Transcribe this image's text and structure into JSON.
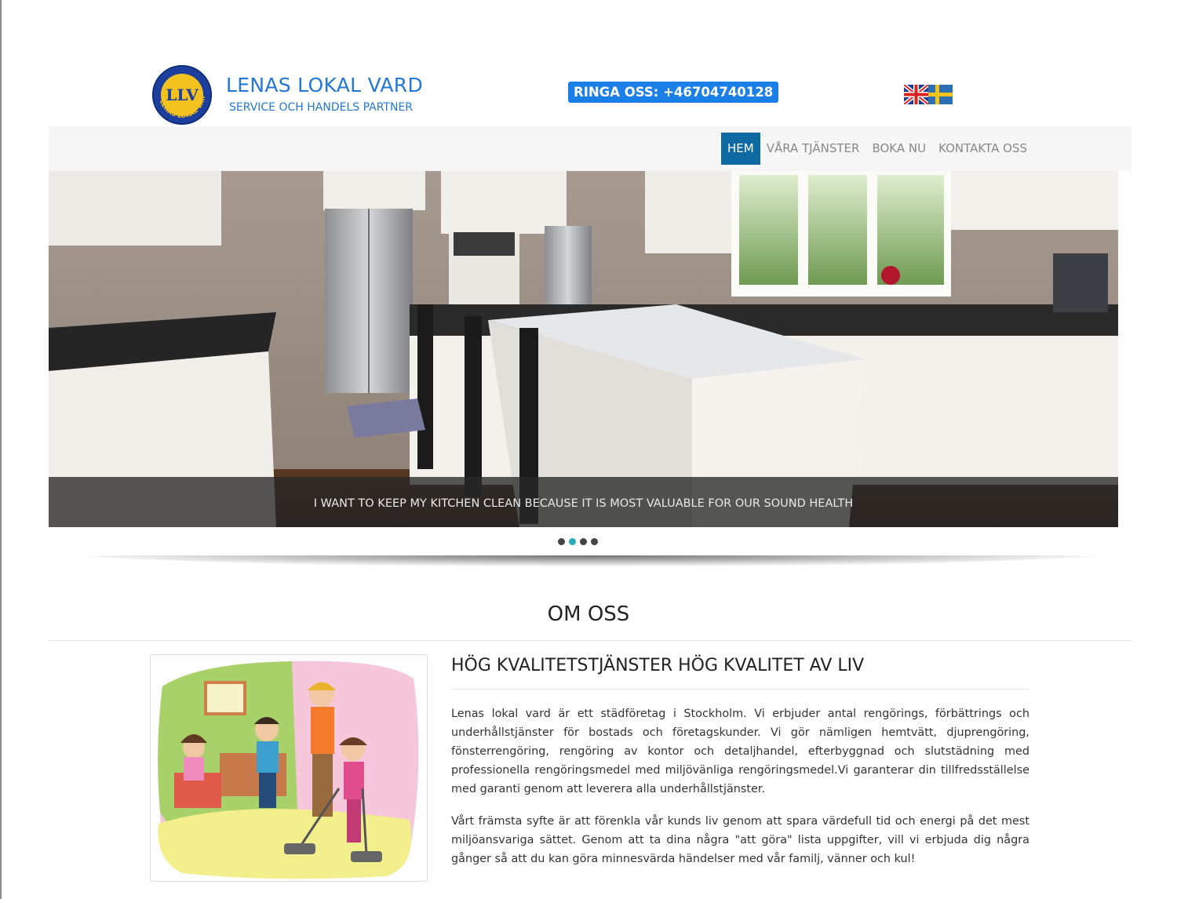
{
  "brand": {
    "title": "LENAS LOKAL VARD",
    "subtitle": "SERVICE OCH HANDELS PARTNER",
    "logo_text": "LENAS LOKAL VARD",
    "logo_initials": "LLV"
  },
  "header": {
    "call_label": "RINGA OSS: +46704740128"
  },
  "languages": [
    {
      "name": "english-flag-icon"
    },
    {
      "name": "swedish-flag-icon"
    }
  ],
  "nav": {
    "items": [
      {
        "label": "HEM",
        "active": true
      },
      {
        "label": "VÅRA TJÄNSTER",
        "active": false
      },
      {
        "label": "BOKA NU",
        "active": false
      },
      {
        "label": "KONTAKTA OSS",
        "active": false
      }
    ]
  },
  "carousel": {
    "caption": "I WANT TO KEEP MY KITCHEN CLEAN BECAUSE IT IS MOST VALUABLE FOR OUR SOUND HEALTH",
    "slide_count": 4,
    "active_index": 1
  },
  "about": {
    "title": "OM OSS",
    "heading": "HÖG KVALITETSTJÄNSTER HÖG KVALITET AV LIV",
    "paragraph1": "Lenas lokal vard är ett städföretag i Stockholm. Vi erbjuder antal rengörings, förbättrings och underhållstjänster för bostads och företagskunder. Vi gör nämligen hemtvätt, djuprengöring, fönsterrengöring, rengöring av kontor och detaljhandel, efterbyggnad och slutstädning med professionella rengöringsmedel med miljövänliga rengöringsmedel.Vi garanterar din tillfredsställelse med garanti genom att leverera alla underhållstjänster.",
    "paragraph2": "Vårt främsta syfte är att förenkla vår kunds liv genom att spara värdefull tid och energi på det mest miljöansvariga sättet. Genom att ta dina några \"att göra\" lista uppgifter, vill vi erbjuda dig några gånger så att du kan göra minnesvärda händelser med vår familj, vänner och kul!"
  },
  "colors": {
    "brand_blue": "#2378d6",
    "call_badge": "#1a7fe6",
    "nav_active": "#0f6aa3",
    "dot_active": "#2aaeb8"
  }
}
